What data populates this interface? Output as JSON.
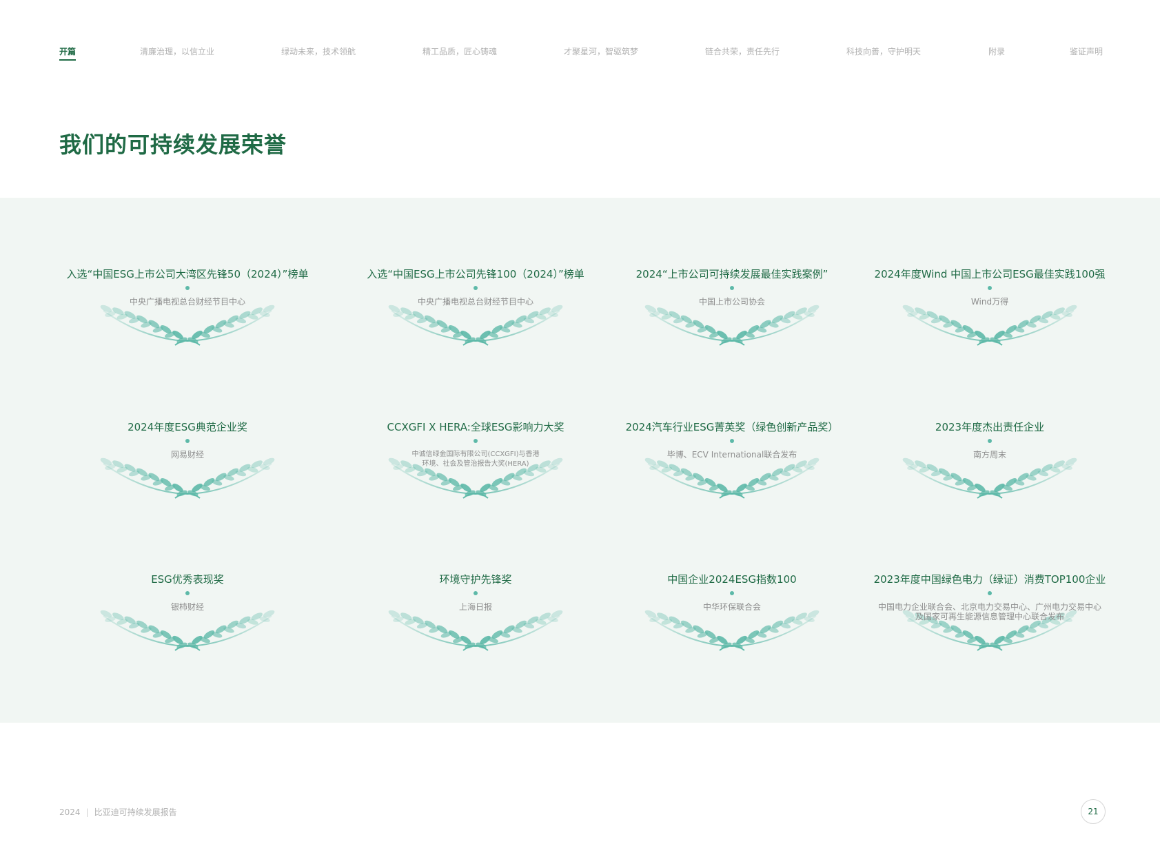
{
  "nav": {
    "items": [
      {
        "label": "开篇",
        "active": true
      },
      {
        "label": "清廉治理，以信立业"
      },
      {
        "label": "绿动未来，技术领航"
      },
      {
        "label": "精工品质，匠心铸魂"
      },
      {
        "label": "才聚星河，智驱筑梦"
      },
      {
        "label": "链合共荣，责任先行"
      },
      {
        "label": "科技向善，守护明天"
      },
      {
        "label": "附录"
      },
      {
        "label": "鉴证声明"
      }
    ]
  },
  "page_title": "我们的可持续发展荣誉",
  "awards": [
    {
      "title": "入选“中国ESG上市公司大湾区先锋50（2024）”榜单",
      "issuer": "中央广播电视总台财经节目中心"
    },
    {
      "title": "入选“中国ESG上市公司先锋100（2024）”榜单",
      "issuer": "中央广播电视总台财经节目中心"
    },
    {
      "title": "2024“上市公司可持续发展最佳实践案例”",
      "issuer": "中国上市公司协会"
    },
    {
      "title": "2024年度Wind 中国上市公司ESG最佳实践100强",
      "issuer": "Wind万得"
    },
    {
      "title": "2024年度ESG典范企业奖",
      "issuer": "网易财经"
    },
    {
      "title": "CCXGFI X HERA:全球ESG影响力大奖",
      "issuer": "中诚信绿金国际有限公司(CCXGFI)与香港",
      "issuer_line2": "环境、社会及管治报告大奖(HERA)"
    },
    {
      "title": "2024汽车行业ESG菁英奖（绿色创新产品奖）",
      "issuer": "毕博、ECV International联合发布"
    },
    {
      "title": "2023年度杰出责任企业",
      "issuer": "南方周末"
    },
    {
      "title": "ESG优秀表现奖",
      "issuer": "银柿财经"
    },
    {
      "title": "环境守护先锋奖",
      "issuer": "上海日报"
    },
    {
      "title": "中国企业2024ESG指数100",
      "issuer": "中华环保联合会"
    },
    {
      "title": "2023年度中国绿色电力（绿证）消费TOP100企业",
      "issuer": "中国电力企业联合会、北京电力交易中心、广州电力交易中心",
      "issuer_line2": "及国家可再生能源信息管理中心联合发布"
    }
  ],
  "footer": {
    "year": "2024",
    "separator": "|",
    "report_name": "比亚迪可持续发展报告",
    "page_number": "21"
  },
  "colors": {
    "brand_green": "#1f6a45",
    "laurel_teal": "#5db9a8",
    "panel_bg": "#f1f6f3"
  }
}
